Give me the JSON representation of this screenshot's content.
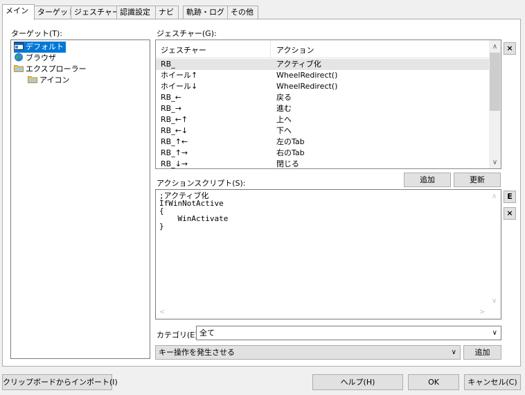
{
  "tabs": [
    {
      "label": "メイン"
    },
    {
      "label": "ターゲット"
    },
    {
      "label": "ジェスチャー"
    },
    {
      "label": "認識設定"
    },
    {
      "label": "ナビ"
    },
    {
      "label": "軌跡・ログ"
    },
    {
      "label": "その他"
    }
  ],
  "target_label": "ターゲット(T):",
  "tree": [
    {
      "label": "デフォルト",
      "icon": "default-window-icon",
      "level": 0,
      "selected": true
    },
    {
      "label": "ブラウザ",
      "icon": "globe-icon",
      "level": 0,
      "selected": false
    },
    {
      "label": "エクスプローラー",
      "icon": "folder-icon",
      "level": 0,
      "selected": false
    },
    {
      "label": "アイコン",
      "icon": "folder-icon",
      "level": 1,
      "selected": false
    }
  ],
  "gesture_label": "ジェスチャー(G):",
  "gesture_list": {
    "col_gesture": "ジェスチャー",
    "col_action": "アクション",
    "rows": [
      {
        "gesture": "RB_",
        "action": "アクティブ化",
        "highlight": true
      },
      {
        "gesture": "ホイール↑",
        "action": "WheelRedirect()",
        "highlight": false
      },
      {
        "gesture": "ホイール↓",
        "action": "WheelRedirect()",
        "highlight": false
      },
      {
        "gesture": "RB_←",
        "action": "戻る",
        "highlight": false
      },
      {
        "gesture": "RB_→",
        "action": "進む",
        "highlight": false
      },
      {
        "gesture": "RB_←↑",
        "action": "上へ",
        "highlight": false
      },
      {
        "gesture": "RB_←↓",
        "action": "下へ",
        "highlight": false
      },
      {
        "gesture": "RB_↑←",
        "action": "左のTab",
        "highlight": false
      },
      {
        "gesture": "RB_↑→",
        "action": "右のTab",
        "highlight": false
      },
      {
        "gesture": "RB_↓→",
        "action": "閉じる",
        "highlight": false
      }
    ]
  },
  "close_x": "×",
  "action_script_label": "アクションスクリプト(S):",
  "add_label": "追加",
  "update_label": "更新",
  "edit_label": "E",
  "script_text": ";アクティブ化\nIfWinNotActive\n{\n    WinActivate\n}",
  "category_label": "カテゴリ(E):",
  "category_value": "全て",
  "key_action_value": "キー操作を発生させる",
  "add2_label": "追加",
  "import_label": "クリップボードからインポート(I)",
  "help_label": "ヘルプ(H)",
  "ok_label": "OK",
  "cancel_label": "キャンセル(C)",
  "colors": {
    "selection": "#0078d7",
    "row_highlight": "#e5e5e5"
  }
}
